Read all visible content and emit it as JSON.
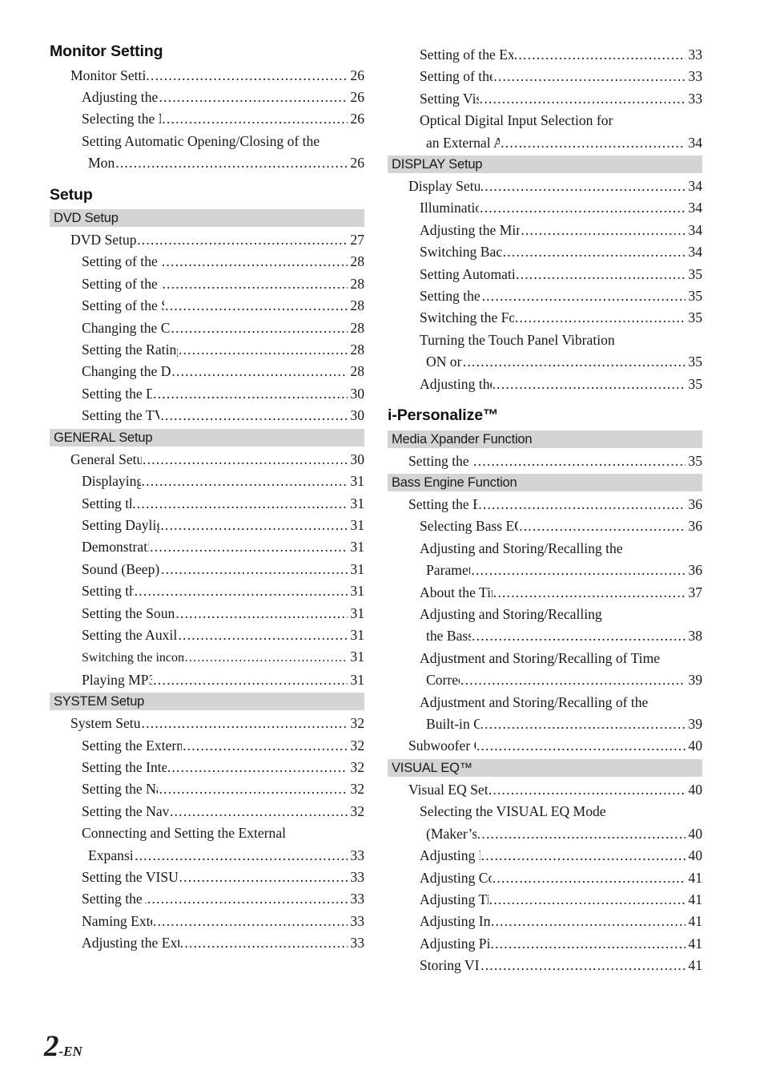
{
  "page": {
    "folio_number": "2",
    "folio_suffix": "-EN",
    "band_color": "#d4d4d4",
    "text_color": "#181818"
  },
  "left_column": {
    "sections": [
      {
        "kind": "major",
        "heading": "Monitor Setting",
        "entries": [
          {
            "level": 1,
            "label": "Monitor Setting Operation",
            "page": "26"
          },
          {
            "level": 2,
            "label": "Adjusting the Monitor Angle",
            "page": "26"
          },
          {
            "level": 2,
            "label": "Selecting the Monitor Position",
            "page": "26"
          },
          {
            "level": 2,
            "label": "Setting Automatic Opening/Closing of the",
            "page": ""
          },
          {
            "level": 3,
            "label": "Monitor",
            "page": "26"
          }
        ]
      },
      {
        "kind": "major",
        "heading": "Setup",
        "entries": []
      },
      {
        "kind": "band",
        "heading": "DVD Setup",
        "entries": [
          {
            "level": 1,
            "label": "DVD Setup Operation",
            "page": "27"
          },
          {
            "level": 2,
            "label": "Setting of the Menu Language",
            "page": "28"
          },
          {
            "level": 2,
            "label": "Setting of the Audio Language",
            "page": "28"
          },
          {
            "level": 2,
            "label": "Setting of the Subtitle Language",
            "page": "28"
          },
          {
            "level": 2,
            "label": "Changing the Country Code Setting",
            "page": "28"
          },
          {
            "level": 2,
            "label": "Setting the Rating Level (Parental Lock)",
            "page": "28"
          },
          {
            "level": 2,
            "label": "Changing the Digital Output Setting",
            "page": "28"
          },
          {
            "level": 2,
            "label": "Setting the Digital Output",
            "page": "30"
          },
          {
            "level": 2,
            "label": "Setting the TV Screen Setting",
            "page": "30"
          }
        ]
      },
      {
        "kind": "band",
        "heading": "GENERAL Setup",
        "entries": [
          {
            "level": 1,
            "label": "General Setup Operation",
            "page": "30"
          },
          {
            "level": 2,
            "label": "Displaying the Time",
            "page": "31"
          },
          {
            "level": 2,
            "label": "Setting the Time",
            "page": "31"
          },
          {
            "level": 2,
            "label": "Setting Daylight Saving Time",
            "page": "31"
          },
          {
            "level": 2,
            "label": "Demonstration Function",
            "page": "31"
          },
          {
            "level": 2,
            "label": "Sound (Beep) Guide Function",
            "page": "31"
          },
          {
            "level": 2,
            "label": "Setting the Scroll",
            "page": "31"
          },
          {
            "level": 2,
            "label": "Setting the Sound Quality of the Tuner",
            "page": "31"
          },
          {
            "level": 2,
            "label": "Setting the Auxiliary Data Field Display",
            "page": "31"
          },
          {
            "level": 2,
            "label": "Switching the incoming calls of the telephone",
            "page": "31",
            "small": true
          },
          {
            "level": 2,
            "label": "Playing MP3/ WMA Data",
            "page": "31"
          }
        ]
      },
      {
        "kind": "band",
        "heading": "SYSTEM Setup",
        "entries": [
          {
            "level": 1,
            "label": "System Setup Operation",
            "page": "32"
          },
          {
            "level": 2,
            "label": "Setting the External Device Interrupt Mode",
            "page": "32"
          },
          {
            "level": 2,
            "label": "Setting the Interrupt Icon Display",
            "page": "32"
          },
          {
            "level": 2,
            "label": "Setting the Navigation Mode",
            "page": "32"
          },
          {
            "level": 2,
            "label": "Setting the Navigation Interruption",
            "page": "32"
          },
          {
            "level": 2,
            "label": "Connecting and Setting the External",
            "page": ""
          },
          {
            "level": 3,
            "label": "Expansion Box",
            "page": "33"
          },
          {
            "level": 2,
            "label": "Setting the VISUALIZER Mode Display",
            "page": "33"
          },
          {
            "level": 2,
            "label": "Setting the AUX Mode",
            "page": "33"
          },
          {
            "level": 2,
            "label": "Naming External Devices",
            "page": "33"
          },
          {
            "level": 2,
            "label": "Adjusting the External Input Audio Level",
            "page": "33"
          }
        ]
      }
    ]
  },
  "right_column": {
    "sections": [
      {
        "kind": "continuation",
        "heading": "",
        "entries": [
          {
            "level": 2,
            "label": "Setting of the External Monitor Output",
            "page": "33"
          },
          {
            "level": 2,
            "label": "Setting of the Rear Camera",
            "page": "33"
          },
          {
            "level": 2,
            "label": "Setting Visual Mode",
            "page": "33"
          },
          {
            "level": 2,
            "label": "Optical Digital Input Selection for",
            "page": ""
          },
          {
            "level": 3,
            "label": "an External Audio Processor",
            "page": "34"
          }
        ]
      },
      {
        "kind": "band",
        "heading": "DISPLAY Setup",
        "entries": [
          {
            "level": 1,
            "label": "Display Setup Operation",
            "page": "34"
          },
          {
            "level": 2,
            "label": "Illumination Control",
            "page": "34"
          },
          {
            "level": 2,
            "label": "Adjusting the Minimum Level of Backlight",
            "page": "34"
          },
          {
            "level": 2,
            "label": "Switching Background Textures",
            "page": "34"
          },
          {
            "level": 2,
            "label": "Setting Automatic Background Textures",
            "page": "35"
          },
          {
            "level": 2,
            "label": "Setting the Font Type",
            "page": "35"
          },
          {
            "level": 2,
            "label": "Switching the Font Back Display Color",
            "page": "35"
          },
          {
            "level": 2,
            "label": "Turning the Touch Panel Vibration",
            "page": ""
          },
          {
            "level": 3,
            "label": "ON or OFF",
            "page": "35"
          },
          {
            "level": 2,
            "label": "Adjusting the Touch Panel",
            "page": "35"
          }
        ]
      },
      {
        "kind": "major",
        "heading": "i-Personalize™",
        "entries": []
      },
      {
        "kind": "band",
        "heading": "Media Xpander Function",
        "entries": [
          {
            "level": 1,
            "label": "Setting the MX mode",
            "page": "35"
          }
        ]
      },
      {
        "kind": "band",
        "heading": "Bass Engine Function",
        "entries": [
          {
            "level": 1,
            "label": "Setting the Bass Engine",
            "page": "36"
          },
          {
            "level": 2,
            "label": "Selecting Bass EQ mode (Maker's setting)",
            "page": "36"
          },
          {
            "level": 2,
            "label": "Adjusting and Storing/Recalling the",
            "page": ""
          },
          {
            "level": 3,
            "label": "Parametric EQ",
            "page": "36"
          },
          {
            "level": 2,
            "label": "About the Time Correction",
            "page": "37"
          },
          {
            "level": 2,
            "label": "Adjusting and Storing/Recalling",
            "page": ""
          },
          {
            "level": 3,
            "label": "the Bass Focus",
            "page": "38"
          },
          {
            "level": 2,
            "label": "Adjustment and Storing/Recalling of Time",
            "page": ""
          },
          {
            "level": 3,
            "label": "Correction",
            "page": "39"
          },
          {
            "level": 2,
            "label": "Adjustment and Storing/Recalling of the",
            "page": ""
          },
          {
            "level": 3,
            "label": "Built-in Crossover",
            "page": "39"
          },
          {
            "level": 1,
            "label": "Subwoofer On and Off",
            "page": "40"
          }
        ]
      },
      {
        "kind": "band",
        "heading": "VISUAL EQ™",
        "entries": [
          {
            "level": 1,
            "label": "Visual EQ Setting Operation",
            "page": "40"
          },
          {
            "level": 2,
            "label": "Selecting the VISUAL EQ Mode",
            "page": ""
          },
          {
            "level": 3,
            "label": "(Maker’s setting)",
            "page": "40"
          },
          {
            "level": 2,
            "label": "Adjusting Brightness",
            "page": "40"
          },
          {
            "level": 2,
            "label": "Adjusting Color of Picture",
            "page": "41"
          },
          {
            "level": 2,
            "label": "Adjusting Tint of Picture",
            "page": "41"
          },
          {
            "level": 2,
            "label": "Adjusting Image Contrast",
            "page": "41"
          },
          {
            "level": 2,
            "label": "Adjusting Picture Quality",
            "page": "41"
          },
          {
            "level": 2,
            "label": "Storing VISUAL EQ",
            "page": "41"
          }
        ]
      }
    ]
  }
}
